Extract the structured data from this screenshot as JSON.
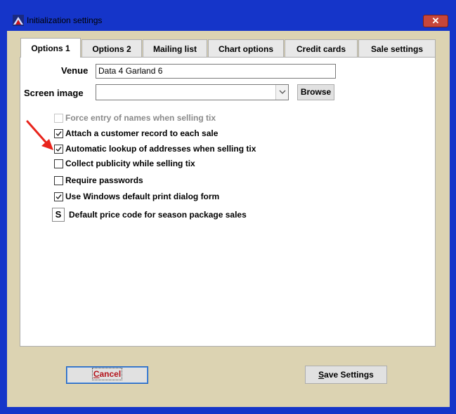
{
  "window": {
    "title": "Initialization settings",
    "close_glyph": "✕"
  },
  "tabs": [
    {
      "label": "Options 1",
      "active": true
    },
    {
      "label": "Options 2",
      "active": false
    },
    {
      "label": "Mailing list",
      "active": false
    },
    {
      "label": "Chart options",
      "active": false
    },
    {
      "label": "Credit cards",
      "active": false
    },
    {
      "label": "Sale settings",
      "active": false
    }
  ],
  "venue": {
    "label": "Venue",
    "value": "Data 4 Garland 6"
  },
  "screen_image": {
    "label": "Screen image",
    "value": "",
    "browse_label": "Browse"
  },
  "options": [
    {
      "label": "Force entry of names when selling tix",
      "checked": false,
      "disabled": true
    },
    {
      "label": "Attach a customer record to each sale",
      "checked": true,
      "disabled": false
    },
    {
      "label": "Automatic lookup of addresses when selling tix",
      "checked": true,
      "disabled": false
    },
    {
      "label": "Collect publicity while selling tix",
      "checked": false,
      "disabled": false
    },
    {
      "label": "Require passwords",
      "checked": false,
      "disabled": false
    },
    {
      "label": "Use Windows default print dialog form",
      "checked": true,
      "disabled": false
    }
  ],
  "price_code": {
    "value": "S",
    "label": "Default price code for season package sales"
  },
  "buttons": {
    "cancel": {
      "first": "C",
      "rest": "ancel"
    },
    "save": {
      "first": "S",
      "rest": "ave Settings"
    }
  },
  "annotation": {
    "arrow_color": "#e8241c",
    "icon": "red-arrow-icon"
  }
}
